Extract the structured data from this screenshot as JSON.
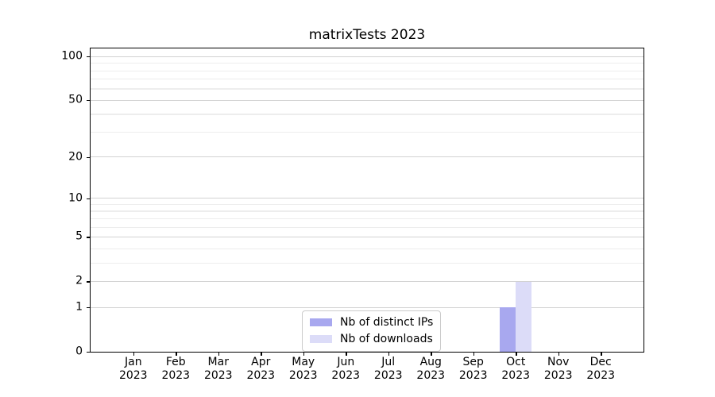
{
  "chart_data": {
    "type": "bar",
    "title": "matrixTests 2023",
    "categories": [
      "Jan",
      "Feb",
      "Mar",
      "Apr",
      "May",
      "Jun",
      "Jul",
      "Aug",
      "Sep",
      "Oct",
      "Nov",
      "Dec"
    ],
    "x_tick_year": "2023",
    "series": [
      {
        "name": "Nb of distinct IPs",
        "color": "#a8a8ef",
        "values": [
          0,
          0,
          0,
          0,
          0,
          0,
          0,
          0,
          0,
          1,
          0,
          0
        ]
      },
      {
        "name": "Nb of downloads",
        "color": "#dcdcf8",
        "values": [
          0,
          0,
          0,
          0,
          0,
          0,
          0,
          0,
          0,
          2,
          0,
          0
        ]
      }
    ],
    "xlabel": "",
    "ylabel": "",
    "y_scale": "log1p",
    "ylim": [
      0,
      113
    ],
    "y_ticks_major": [
      0,
      1,
      2,
      5,
      10,
      20,
      50,
      100
    ],
    "y_ticks_minor": [
      3,
      4,
      6,
      7,
      8,
      9,
      30,
      40,
      60,
      70,
      80,
      90
    ],
    "grid": true,
    "legend_position": "lower-center-inside",
    "colors": {
      "grid_major": "#d2d2d2",
      "grid_minor": "#ededed",
      "axis": "#000000",
      "text": "#000000"
    }
  }
}
